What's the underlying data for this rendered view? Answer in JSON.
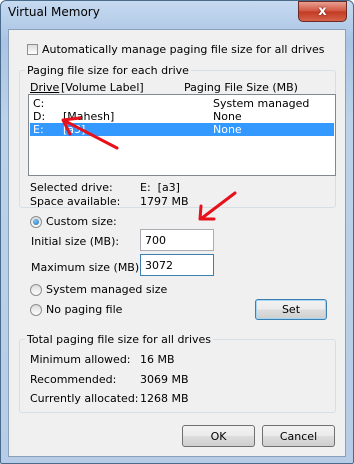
{
  "window": {
    "title": "Virtual Memory",
    "close_glyph": "x"
  },
  "auto_manage": {
    "label": "Automatically manage paging file size for all drives",
    "checked": false
  },
  "paging_group": {
    "title": "Paging file size for each drive",
    "columns": {
      "drive": "Drive",
      "volume": "[Volume Label]",
      "size": "Paging File Size (MB)"
    },
    "drives": [
      {
        "drive": "C:",
        "label": "",
        "size": "System managed",
        "selected": false
      },
      {
        "drive": "D:",
        "label": "[Mahesh]",
        "size": "None",
        "selected": false
      },
      {
        "drive": "E:",
        "label": "[a3]",
        "size": "None",
        "selected": true
      }
    ]
  },
  "selected_drive": {
    "label": "Selected drive:",
    "value": "E:  [a3]"
  },
  "space_available": {
    "label": "Space available:",
    "value": "1797 MB"
  },
  "custom_size": {
    "label": "Custom size:",
    "checked": true,
    "initial": {
      "label": "Initial size (MB):",
      "value": "700"
    },
    "maximum": {
      "label": "Maximum size (MB):",
      "value": "3072"
    }
  },
  "system_managed": {
    "label": "System managed size",
    "checked": false
  },
  "no_paging": {
    "label": "No paging file",
    "checked": false
  },
  "set_button": "Set",
  "totals": {
    "title": "Total paging file size for all drives",
    "minimum": {
      "label": "Minimum allowed:",
      "value": "16 MB"
    },
    "recommended": {
      "label": "Recommended:",
      "value": "3069 MB"
    },
    "allocated": {
      "label": "Currently allocated:",
      "value": "1268 MB"
    }
  },
  "buttons": {
    "ok": "OK",
    "cancel": "Cancel"
  },
  "annotation_color": "#e8101a"
}
